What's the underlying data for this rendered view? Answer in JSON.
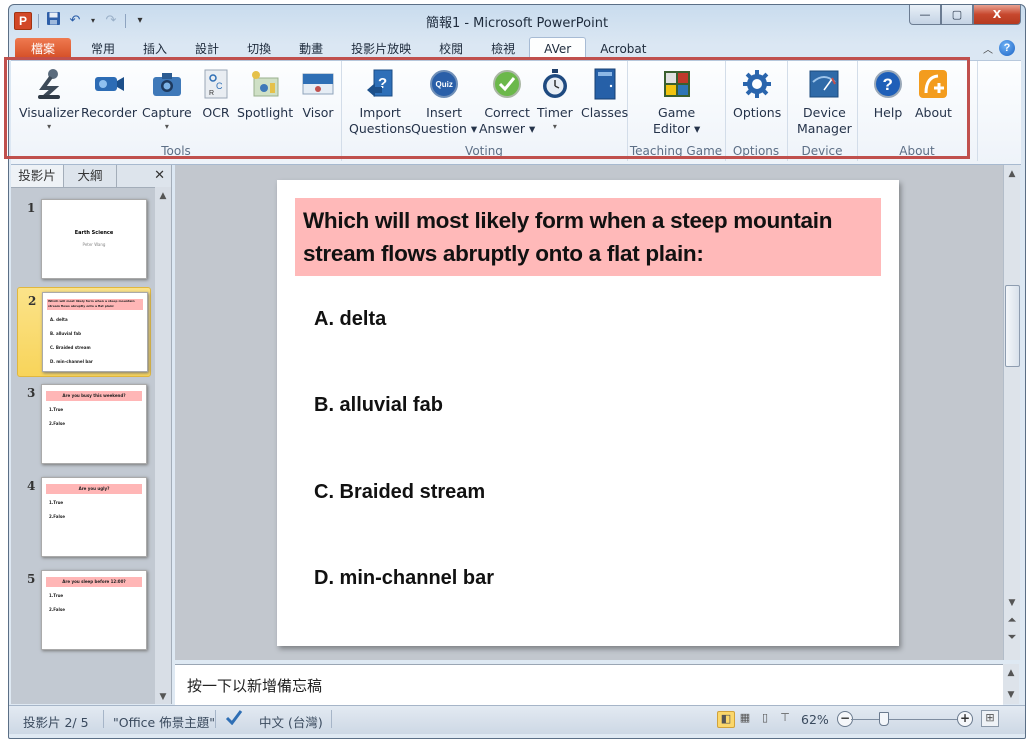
{
  "window": {
    "title": "簡報1 - Microsoft PowerPoint",
    "controls": {
      "minimize": "—",
      "maximize": "▢",
      "close": "X"
    }
  },
  "quick_access": {
    "app_icon": "P",
    "save": "save-icon",
    "undo": "undo-icon",
    "redo": "redo-icon",
    "customize": "▾"
  },
  "tabs": [
    {
      "label": "檔案",
      "kind": "file"
    },
    {
      "label": "常用"
    },
    {
      "label": "插入"
    },
    {
      "label": "設計"
    },
    {
      "label": "切換"
    },
    {
      "label": "動畫"
    },
    {
      "label": "投影片放映"
    },
    {
      "label": "校閱"
    },
    {
      "label": "檢視"
    },
    {
      "label": "AVer",
      "active": true
    },
    {
      "label": "Acrobat"
    }
  ],
  "ribbon": {
    "groups": [
      {
        "label": "Tools",
        "buttons": [
          {
            "label": "Visualizer",
            "dropdown": true
          },
          {
            "label": "Recorder"
          },
          {
            "label": "Capture",
            "dropdown": true
          },
          {
            "label": "OCR"
          },
          {
            "label": "Spotlight"
          },
          {
            "label": "Visor"
          }
        ]
      },
      {
        "label": "Voting",
        "buttons": [
          {
            "label": "Import",
            "label2": "Questions"
          },
          {
            "label": "Insert",
            "label2": "Question ▾"
          },
          {
            "label": "Correct",
            "label2": "Answer ▾"
          },
          {
            "label": "Timer",
            "dropdown": true
          },
          {
            "label": "Classes"
          }
        ]
      },
      {
        "label": "Teaching Game",
        "buttons": [
          {
            "label": "Game",
            "label2": "Editor ▾"
          }
        ]
      },
      {
        "label": "Options",
        "buttons": [
          {
            "label": "Options"
          }
        ]
      },
      {
        "label": "Device",
        "buttons": [
          {
            "label": "Device",
            "label2": "Manager"
          }
        ]
      },
      {
        "label": "About",
        "buttons": [
          {
            "label": "Help"
          },
          {
            "label": "About"
          }
        ]
      }
    ]
  },
  "left_panel": {
    "tabs": [
      "投影片",
      "大綱"
    ],
    "close": "✕",
    "slides": [
      {
        "num": "1",
        "title": "Earth Science",
        "subtitle": "Peter Wang"
      },
      {
        "num": "2",
        "header": "Which will most likely form when a steep mountain stream flows abruptly onto a flat plain:",
        "lines": [
          "A. delta",
          "B. alluvial fab",
          "C. Braided stream",
          "D. min-channel bar"
        ],
        "selected": true
      },
      {
        "num": "3",
        "header": "Are you busy this weekend?",
        "lines": [
          "1.True",
          "2.False"
        ]
      },
      {
        "num": "4",
        "header": "Are you ugly?",
        "lines": [
          "1.True",
          "2.False"
        ]
      },
      {
        "num": "5",
        "header": "Are you sleep before 12:00?",
        "lines": [
          "1.True",
          "2.False"
        ]
      }
    ]
  },
  "slide": {
    "question": "Which will most likely form when a steep mountain stream flows abruptly onto a flat plain:",
    "options": [
      "A. delta",
      "B. alluvial fab",
      "C. Braided stream",
      "D. min-channel bar"
    ],
    "question_bg": "#ffb9b9"
  },
  "notes": {
    "placeholder": "按一下以新增備忘稿"
  },
  "status": {
    "slide_counter": "投影片 2/ 5",
    "theme": "\"Office 佈景主題\"",
    "language": "中文 (台灣)",
    "zoom": "62%",
    "zoom_value_percent": 62
  },
  "colors": {
    "accent_red": "#c0504d",
    "file_tab": "#d34b22",
    "selected_thumb": "#f8d45a"
  }
}
